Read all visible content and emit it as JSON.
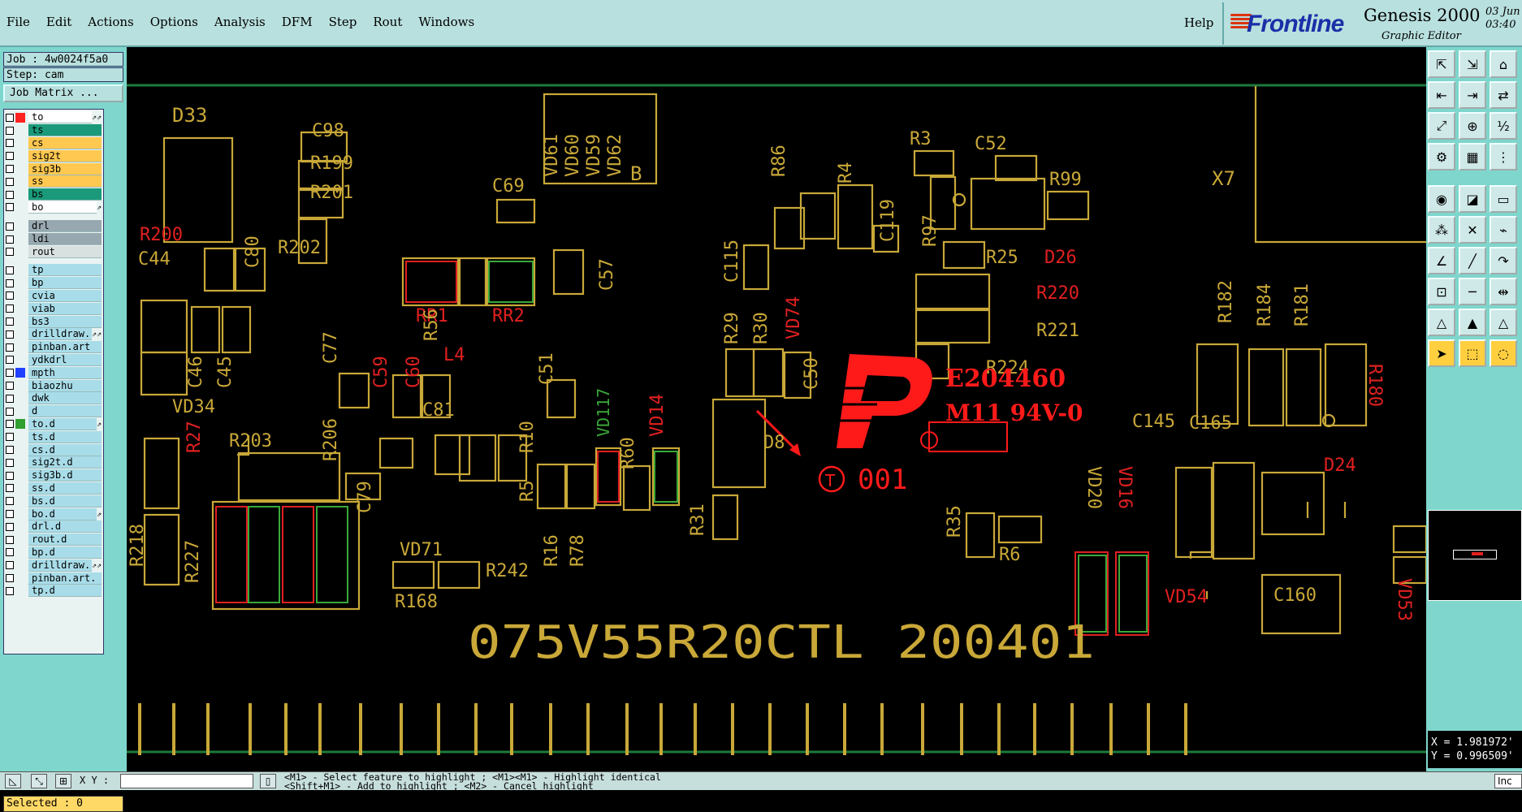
{
  "menu": [
    "File",
    "Edit",
    "Actions",
    "Options",
    "Analysis",
    "DFM",
    "Step",
    "Rout",
    "Windows"
  ],
  "help_label": "Help",
  "brand": {
    "name": "Frontline",
    "product": "Genesis 2000",
    "subtitle": "Graphic Editor",
    "date_line1": "03 Jun",
    "date_line2": "03:40"
  },
  "job": "Job : 4w0024f5a0",
  "step": "Step: cam",
  "job_matrix": "Job Matrix ...",
  "layers": {
    "board": [
      {
        "name": "to",
        "color": "#ffffff",
        "mark": "#ff2020",
        "extra": "⇗⇗"
      },
      {
        "name": "ts",
        "color": "#1a9a7a",
        "mark": "",
        "extra": ""
      },
      {
        "name": "cs",
        "color": "#ffc850",
        "mark": "",
        "extra": ""
      },
      {
        "name": "sig2t",
        "color": "#ffc850",
        "mark": "",
        "extra": ""
      },
      {
        "name": "sig3b",
        "color": "#ffc850",
        "mark": "",
        "extra": ""
      },
      {
        "name": "ss",
        "color": "#ffc850",
        "mark": "",
        "extra": ""
      },
      {
        "name": "bs",
        "color": "#1a9a7a",
        "mark": "",
        "extra": ""
      },
      {
        "name": "bo",
        "color": "#ffffff",
        "mark": "",
        "extra": "⇗"
      }
    ],
    "drill": [
      {
        "name": "drl",
        "color": "#98a8b0",
        "mark": "",
        "extra": ""
      },
      {
        "name": "ldi",
        "color": "#98a8b0",
        "mark": "",
        "extra": ""
      },
      {
        "name": "rout",
        "color": "#d8e0e0",
        "mark": "",
        "extra": ""
      }
    ],
    "misc": [
      {
        "name": "tp",
        "color": "#a8dce8",
        "mark": "",
        "extra": ""
      },
      {
        "name": "bp",
        "color": "#a8dce8",
        "mark": "",
        "extra": ""
      },
      {
        "name": "cvia",
        "color": "#a8dce8",
        "mark": "",
        "extra": ""
      },
      {
        "name": "viab",
        "color": "#a8dce8",
        "mark": "",
        "extra": ""
      },
      {
        "name": "bs3",
        "color": "#a8dce8",
        "mark": "",
        "extra": ""
      },
      {
        "name": "drilldraw.",
        "color": "#a8dce8",
        "mark": "",
        "extra": "⇗⇗"
      },
      {
        "name": "pinban.art",
        "color": "#a8dce8",
        "mark": "",
        "extra": ""
      },
      {
        "name": "ydkdrl",
        "color": "#a8dce8",
        "mark": "",
        "extra": ""
      },
      {
        "name": "mpth",
        "color": "#a8dce8",
        "mark": "#2040ff",
        "extra": ""
      },
      {
        "name": "biaozhu",
        "color": "#a8dce8",
        "mark": "",
        "extra": ""
      },
      {
        "name": "dwk",
        "color": "#a8dce8",
        "mark": "",
        "extra": ""
      },
      {
        "name": "d",
        "color": "#a8dce8",
        "mark": "",
        "extra": ""
      },
      {
        "name": "to.d",
        "color": "#a8dce8",
        "mark": "#30a030",
        "extra": "⇗"
      },
      {
        "name": "ts.d",
        "color": "#a8dce8",
        "mark": "",
        "extra": ""
      },
      {
        "name": "cs.d",
        "color": "#a8dce8",
        "mark": "",
        "extra": ""
      },
      {
        "name": "sig2t.d",
        "color": "#a8dce8",
        "mark": "",
        "extra": ""
      },
      {
        "name": "sig3b.d",
        "color": "#a8dce8",
        "mark": "",
        "extra": ""
      },
      {
        "name": "ss.d",
        "color": "#a8dce8",
        "mark": "",
        "extra": ""
      },
      {
        "name": "bs.d",
        "color": "#a8dce8",
        "mark": "",
        "extra": ""
      },
      {
        "name": "bo.d",
        "color": "#a8dce8",
        "mark": "",
        "extra": "⇗"
      },
      {
        "name": "drl.d",
        "color": "#a8dce8",
        "mark": "",
        "extra": ""
      },
      {
        "name": "rout.d",
        "color": "#a8dce8",
        "mark": "",
        "extra": ""
      },
      {
        "name": "bp.d",
        "color": "#a8dce8",
        "mark": "",
        "extra": ""
      },
      {
        "name": "drilldraw.",
        "color": "#a8dce8",
        "mark": "",
        "extra": "⇗⇗"
      },
      {
        "name": "pinban.art.",
        "color": "#a8dce8",
        "mark": "",
        "extra": ""
      },
      {
        "name": "tp.d",
        "color": "#a8dce8",
        "mark": "",
        "extra": ""
      }
    ]
  },
  "selected": "Selected : 0",
  "coords": {
    "x": "X = 1.981972'",
    "y": "Y = 0.996509'"
  },
  "status": {
    "xy_label": "X Y :",
    "msg1": "<M1> - Select feature to highlight ; <M1><M1> - Highlight identical",
    "msg2": "<Shift+M1> - Add to highlight ; <M2> - Cancel highlight",
    "ind": "Inc"
  },
  "pcb": {
    "designators": [
      "D33",
      "C98",
      "R199",
      "R201",
      "R202",
      "R200",
      "C44",
      "C80",
      "C46",
      "C45",
      "VD34",
      "R203",
      "R27",
      "R218",
      "R227",
      "C77",
      "R206",
      "C79",
      "RR1",
      "R56",
      "RR2",
      "C59",
      "C60",
      "L4",
      "C81",
      "C51",
      "C57",
      "C69",
      "VD61",
      "VD60",
      "VD59",
      "VD62",
      "B",
      "R10",
      "R5",
      "R16",
      "R78",
      "R60",
      "VD117",
      "VD14",
      "R29",
      "R30",
      "VD74",
      "C115",
      "R86",
      "R4",
      "C119",
      "C50",
      "R31",
      "D8",
      "R3",
      "C52",
      "R99",
      "R97",
      "R25",
      "D26",
      "R220",
      "R221",
      "R224",
      "R35",
      "R6",
      "X7",
      "R182",
      "R184",
      "R181",
      "R180",
      "C145",
      "C165",
      "D24",
      "VD20",
      "VD16",
      "VD54",
      "C160",
      "VD53",
      "VD71",
      "R168",
      "R242"
    ],
    "board_text": "075V55R20CTL 200401",
    "ul_code": "E204460",
    "ul_grade": "M11 94V-0",
    "date_code": "001",
    "marking": "T"
  },
  "colors": {
    "silk": "#c9a838",
    "pad_red": "#e02020",
    "pad_green": "#3aa83a",
    "ul_red": "#ff1a1a",
    "bg": "#000000"
  }
}
